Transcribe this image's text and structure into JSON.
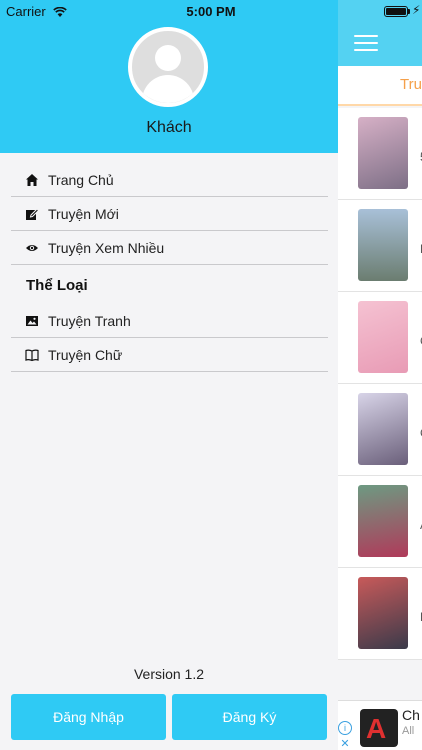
{
  "status_bar": {
    "carrier": "Carrier",
    "time": "5:00 PM"
  },
  "background_app": {
    "tab_label": "Tru",
    "rows": [
      {
        "letter": "5",
        "colors": [
          "#d6b0c6",
          "#7d6f86"
        ]
      },
      {
        "letter": "D",
        "colors": [
          "#a8c0d8",
          "#6b7d70"
        ]
      },
      {
        "letter": "C",
        "colors": [
          "#f5c2d2",
          "#e89bb5"
        ]
      },
      {
        "letter": "C",
        "colors": [
          "#d8d4e8",
          "#6a5f7a"
        ]
      },
      {
        "letter": "A",
        "colors": [
          "#6d9a82",
          "#b03a5a"
        ]
      },
      {
        "letter": "F",
        "colors": [
          "#c85a5a",
          "#3a3a4a"
        ]
      }
    ],
    "ad": {
      "title": "Ch",
      "subtitle": "All"
    }
  },
  "drawer": {
    "user_name": "Khách",
    "menu_items": [
      {
        "label": "Trang Chủ",
        "icon": "home-icon"
      },
      {
        "label": "Truyện Mới",
        "icon": "edit-icon"
      },
      {
        "label": "Truyện Xem Nhiều",
        "icon": "eye-icon"
      }
    ],
    "section_title": "Thể Loại",
    "category_items": [
      {
        "label": "Truyện Tranh",
        "icon": "image-icon"
      },
      {
        "label": "Truyện Chữ",
        "icon": "book-icon"
      }
    ],
    "version": "Version 1.2",
    "login_label": "Đăng Nhập",
    "register_label": "Đăng Ký"
  }
}
